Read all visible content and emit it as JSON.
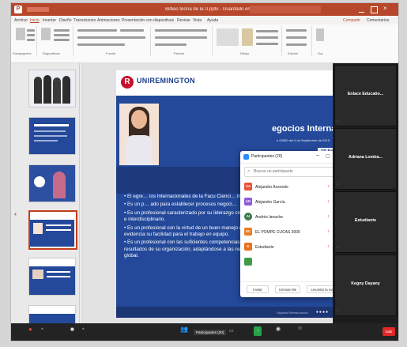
{
  "titlebar": {
    "title": "Bilbao teoría de la U.pptx - Guardado en este PC"
  },
  "menu": [
    "Archivo",
    "Inicio",
    "Insertar",
    "Diseño",
    "Transiciones",
    "Animaciones",
    "Presentación con diapositivas",
    "Revisar",
    "Vista",
    "Ayuda"
  ],
  "share": [
    "Compartir",
    "Comentarios"
  ],
  "ribbon_groups": [
    "Portapapeles",
    "Diapositivas",
    "Fuente",
    "Párrafo",
    "Dibujo",
    "Edición",
    "Voz"
  ],
  "slide": {
    "brand": "UNIREMINGTON",
    "title": "egocios Internaciona",
    "subtitle": "n 09550 del 4 de Septiembre de 2015",
    "semester": "10 Sem",
    "section_title": "al",
    "bullets": [
      "El egre… ios Internacionales de la Facu Cienci… integro y responsable.",
      "Es un p… ado para establecer procesos negoci…",
      "Es un profesional caracterizado por su liderazgo creativo, innovador, emprendedor, proactivo e interdisciplinario.",
      "Es un profesional con la virtud de un buen manejo de las relaciones interpersonales evidencia su facilidad para el trabajo en equipo.",
      "Es un profesional con las suficientes competencias para contribuir al logro de metas resultados de su organización, adaptándose a las nuevas tendencias del mercado y sociedad global."
    ],
    "footer": "Vigilada Mineducación"
  },
  "participants": {
    "title": "Participantes (20)",
    "search_placeholder": "Buscar un participante",
    "list": [
      {
        "initials": "AA",
        "name": "Alejandro Acevedo",
        "color": "#e8523a"
      },
      {
        "initials": "AG",
        "name": "Alejandro García",
        "color": "#8e5bd8"
      },
      {
        "initials": "AI",
        "name": "Andrés Ianache",
        "color": "#3c7a4c"
      },
      {
        "initials": "EC",
        "name": "EL POMPE CUCAS 3000",
        "color": "#e87d1e"
      },
      {
        "initials": "E",
        "name": "Estudiante",
        "color": "#e8701e"
      },
      {
        "initials": "",
        "name": "",
        "color": "#3f9b48"
      }
    ],
    "buttons": [
      "Invitar",
      "Unmute Me",
      "Levantar la mano"
    ]
  },
  "gallery": [
    "Enlace Educatio...",
    "Adriana Lomba...",
    "Estudiante",
    "Kegny Dayany"
  ],
  "toolbar": {
    "participants_label": "Participantes (20)",
    "end": "Salir"
  }
}
